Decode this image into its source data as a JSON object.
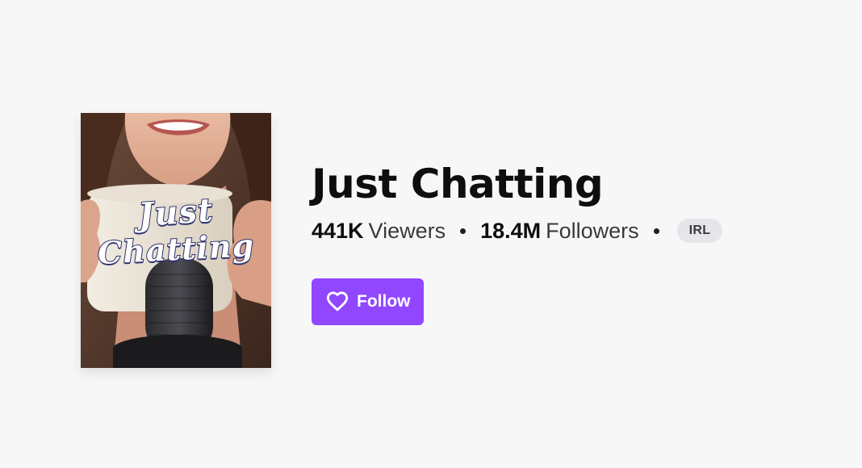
{
  "category": {
    "title": "Just Chatting",
    "box_art": {
      "line1": "Just",
      "line2": "Chatting"
    },
    "stats": {
      "viewers_count": "441K",
      "viewers_label": "Viewers",
      "followers_count": "18.4M",
      "followers_label": "Followers"
    },
    "tag": "IRL",
    "follow_label": "Follow",
    "icons": {
      "follow": "heart-icon"
    }
  },
  "colors": {
    "brand": "#9147ff",
    "background": "#f7f7f8",
    "text": "#0e0e10",
    "tag_bg": "#e6e6ea"
  }
}
